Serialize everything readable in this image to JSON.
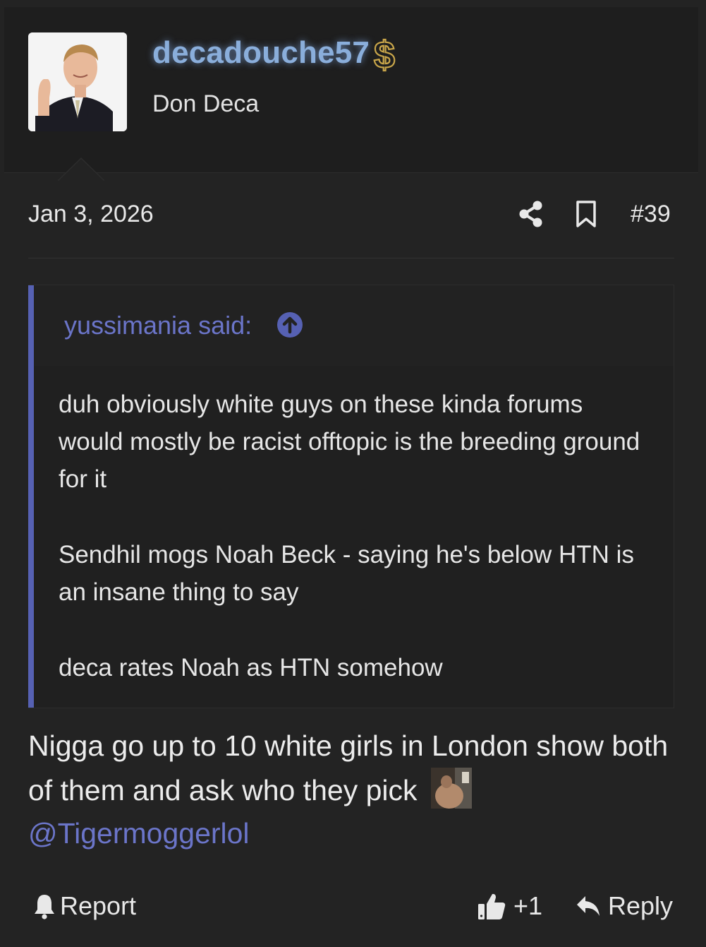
{
  "user": {
    "username": "decadouche57",
    "title": "Don Deca",
    "badge_icon": "dollar-sign-icon",
    "username_color": "#8aaedb"
  },
  "post": {
    "date": "Jan 3, 2026",
    "number": "#39",
    "quote": {
      "author_label": "yussimania said:",
      "paragraphs": [
        "duh obviously white guys on these kinda forums would mostly be racist offtopic is the breeding ground for it",
        "Sendhil mogs Noah Beck - saying he's below HTN is an insane thing to say",
        "deca rates Noah as HTN somehow"
      ]
    },
    "message": {
      "line1": "Nigga go up to 10 white girls in London show both of them and ask who they pick",
      "mention": "@Tigermoggerlol"
    }
  },
  "actions": {
    "report": "Report",
    "like_count": "+1",
    "reply": "Reply"
  },
  "colors": {
    "background": "#232323",
    "quote_accent": "#5661b3",
    "link": "#6b75c9"
  }
}
